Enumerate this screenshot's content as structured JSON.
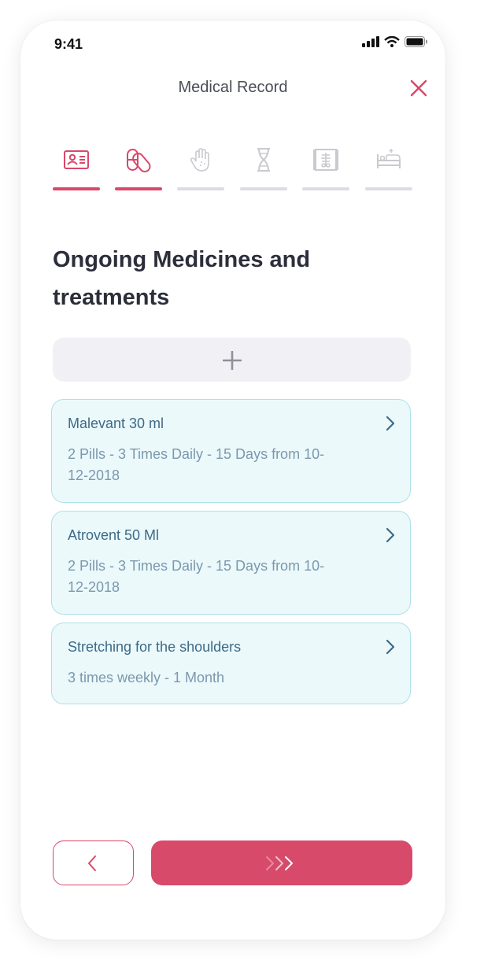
{
  "status": {
    "time": "9:41"
  },
  "header": {
    "title": "Medical Record"
  },
  "steps": [
    {
      "icon": "id-card-icon",
      "active": true
    },
    {
      "icon": "pills-icon",
      "active": true
    },
    {
      "icon": "hand-icon",
      "active": false
    },
    {
      "icon": "dna-icon",
      "active": false
    },
    {
      "icon": "xray-icon",
      "active": false
    },
    {
      "icon": "hospital-bed-icon",
      "active": false
    }
  ],
  "page": {
    "title": "Ongoing Medicines and treatments"
  },
  "add_button": {
    "icon": "plus-icon"
  },
  "items": [
    {
      "name": "Malevant 30 ml",
      "detail": "2 Pills - 3 Times Daily - 15 Days from 10-12-2018"
    },
    {
      "name": "Atrovent 50 Ml",
      "detail": "2 Pills - 3 Times Daily - 15 Days from 10-12-2018"
    },
    {
      "name": "Stretching for the shoulders",
      "detail": "3 times weekly - 1 Month"
    }
  ],
  "footer": {
    "back_icon": "chevron-left-icon",
    "next_icon": "triple-chevron-right-icon"
  },
  "colors": {
    "accent": "#d84a6a",
    "card_bg": "#ebf9fb",
    "card_border": "#aee0ea",
    "inactive": "#dcdde2"
  }
}
